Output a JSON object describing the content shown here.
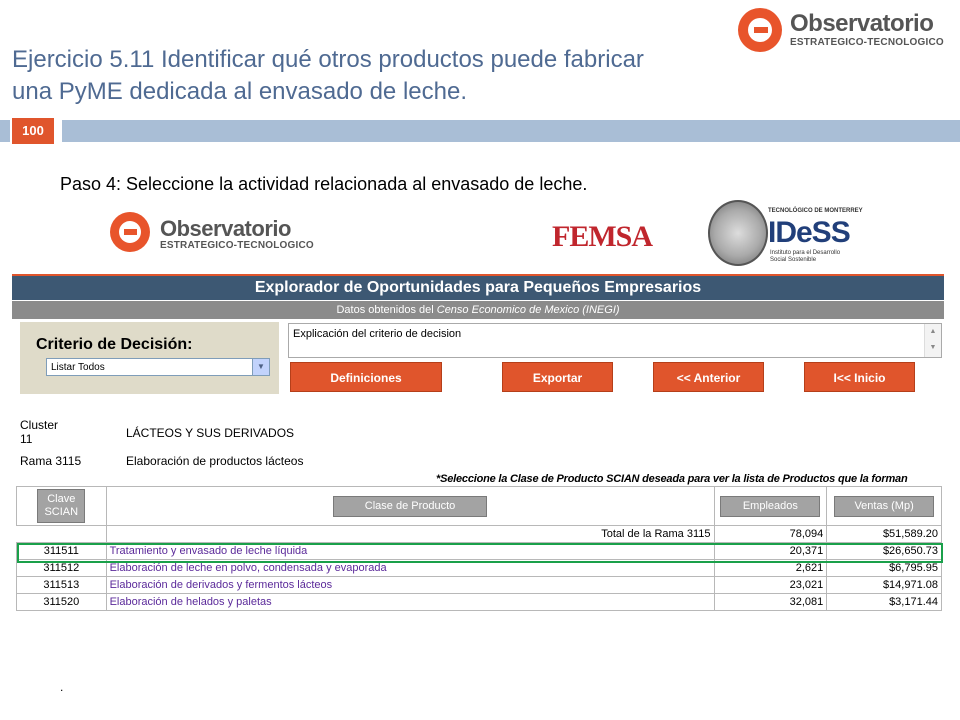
{
  "slide": {
    "title_line1": "Ejercicio 5.11 Identificar qué otros productos puede fabricar",
    "title_line2": "una PyME dedicada al envasado de leche.",
    "page_number": "100",
    "step_text": "Paso 4: Seleccione la actividad relacionada al envasado de leche.",
    "footer_dot": "."
  },
  "logos": {
    "observatorio_name": "Observatorio",
    "observatorio_sub": "ESTRATEGICO-TECNOLOGICO",
    "femsa": "FEMSA",
    "ides_top": "TECNOLÓGICO DE MONTERREY",
    "ides": "IDeSS",
    "ides_sub": "Instituto para el Desarrollo Social Sostenible"
  },
  "app": {
    "header": "Explorador de Oportunidades para Pequeños Empresarios",
    "subheader_prefix": "Datos obtenidos del ",
    "subheader_source": "Censo Economico de Mexico (INEGI)",
    "criterio_label": "Criterio de Decisión:",
    "criterio_selected": "Listar Todos",
    "explain_text": "Explicación del criterio de decision",
    "buttons": {
      "definiciones": "Definiciones",
      "exportar": "Exportar",
      "anterior": "<< Anterior",
      "inicio": "I<< Inicio"
    },
    "cluster_label_1": "Cluster",
    "cluster_label_2": "11",
    "cluster_value": "LÁCTEOS Y SUS DERIVADOS",
    "rama_label": "Rama 3115",
    "rama_value": "Elaboración de productos lácteos",
    "instruction": "*Seleccione la Clase de Producto SCIAN deseada para ver la lista de Productos que la forman"
  },
  "table": {
    "headers": {
      "clave_1": "Clave",
      "clave_2": "SCIAN",
      "clase": "Clase de Producto",
      "empleados": "Empleados",
      "ventas": "Ventas  (Mp)"
    },
    "total": {
      "label": "Total de la Rama 3115",
      "empleados": "78,094",
      "ventas": "$51,589.20"
    },
    "rows": [
      {
        "code": "311511",
        "name": "Tratamiento y envasado de leche líquida",
        "empleados": "20,371",
        "ventas": "$26,650.73"
      },
      {
        "code": "311512",
        "name": "Elaboración de leche en polvo, condensada y evaporada",
        "empleados": "2,621",
        "ventas": "$6,795.95"
      },
      {
        "code": "311513",
        "name": "Elaboración de derivados y fermentos lácteos",
        "empleados": "23,021",
        "ventas": "$14,971.08"
      },
      {
        "code": "311520",
        "name": "Elaboración de helados y paletas",
        "empleados": "32,081",
        "ventas": "$3,171.44"
      }
    ]
  }
}
